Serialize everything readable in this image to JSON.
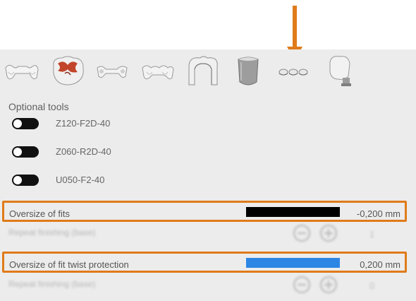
{
  "colors": {
    "accent": "#e07b1a",
    "panel_bg": "#ececec",
    "oversize_bar": "#000000",
    "twist_bar": "#2d86e4"
  },
  "toolbar": {
    "icons": [
      {
        "name": "bridge-icon"
      },
      {
        "name": "inlay-onlay-icon"
      },
      {
        "name": "bridge-frame-icon"
      },
      {
        "name": "multi-unit-bridge-icon"
      },
      {
        "name": "crown-coping-icon"
      },
      {
        "name": "veneer-icon"
      },
      {
        "name": "attachment-icon"
      },
      {
        "name": "abutment-icon"
      }
    ]
  },
  "optional_tools": {
    "title": "Optional tools",
    "items": [
      {
        "label": "Z120-F2D-40",
        "enabled": false
      },
      {
        "label": "Z060-R2D-40",
        "enabled": false
      },
      {
        "label": "U050-F2-40",
        "enabled": false
      }
    ]
  },
  "oversize_fits": {
    "label": "Oversize of fits",
    "value": "-0,200 mm"
  },
  "repeat_finishing_1": {
    "label": "Repeat finishing (base)",
    "value": "1"
  },
  "oversize_twist": {
    "label": "Oversize of fit twist protection",
    "value": "0,200 mm"
  },
  "repeat_finishing_2": {
    "label": "Repeat finishing (base)",
    "value": "0"
  }
}
